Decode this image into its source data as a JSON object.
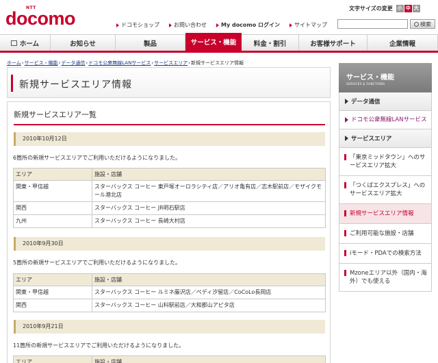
{
  "header": {
    "logo_small": "NTT",
    "logo_brand": "docomo",
    "utility_links": [
      "ドコモショップ",
      "お問い合わせ",
      "My docomo ログイン",
      "サイトマップ"
    ],
    "font_size_label": "文字サイズの変更",
    "font_size_options": [
      "小",
      "中",
      "大"
    ],
    "search_placeholder": "",
    "search_button": "検索"
  },
  "nav": {
    "items": [
      "ホーム",
      "お知らせ",
      "製品",
      "サービス・機能",
      "料金・割引",
      "お客様サポート",
      "企業情報"
    ],
    "active": "サービス・機能"
  },
  "breadcrumb": {
    "links": [
      "ホーム",
      "サービス・機能",
      "データ通信",
      "ドコモ公衆無線LANサービス",
      "サービスエリア"
    ],
    "current": "新規サービスエリア情報"
  },
  "page_title": "新規サービスエリア情報",
  "main": {
    "section_title": "新規サービスエリア一覧",
    "entries": [
      {
        "date": "2010年10月12日",
        "desc": "6箇所の新規サービスエリアでご利用いただけるようになりました。",
        "headers": [
          "エリア",
          "施設・店舗"
        ],
        "rows": [
          {
            "area": "関東・甲信越",
            "facility": "スターバックス コーヒー 東戸塚オーロラシティ店／アリオ亀有店／志木駅前店／モザイクモール港北店"
          },
          {
            "area": "関西",
            "facility": "スターバックス コーヒー JR明石駅店"
          },
          {
            "area": "九州",
            "facility": "スターバックス コーヒー 長崎大村店"
          }
        ]
      },
      {
        "date": "2010年9月30日",
        "desc": "5箇所の新規サービスエリアでご利用いただけるようになりました。",
        "headers": [
          "エリア",
          "施設・店舗"
        ],
        "rows": [
          {
            "area": "関東・甲信越",
            "facility": "スターバックス コーヒー ルミネ藤沢店／ペディ汐留店／CoCoLo長岡店"
          },
          {
            "area": "関西",
            "facility": "スターバックス コーヒー 山科駅前店／大和郡山アピタ店"
          }
        ]
      },
      {
        "date": "2010年9月21日",
        "desc": "11箇所の新規サービスエリアでご利用いただけるようになりました。",
        "headers": [
          "エリア",
          "施設・店舗"
        ],
        "rows": []
      }
    ]
  },
  "sidebar": {
    "title": "サービス・機能",
    "subtitle": "SERVICES & FUNCTIONS",
    "cat1": "データ通信",
    "sub1": "ドコモ公衆無線LANサービス",
    "cat2": "サービスエリア",
    "links": [
      "「東京ミッドタウン」へのサービスエリア拡大",
      "「つくばエクスプレス」へのサービスエリア拡大",
      "新規サービスエリア情報",
      "ご利用可能な施設・店舗",
      "iモード・PDAでの検索方法",
      "Mzoneエリア以外（国内・海外）でも使える"
    ],
    "active_index": 2
  },
  "colors": {
    "brand_red": "#c8002b",
    "date_bar_bg": "#efe9d6",
    "link_blue": "#1a3a8a",
    "sub_purple": "#8a1a6b"
  }
}
